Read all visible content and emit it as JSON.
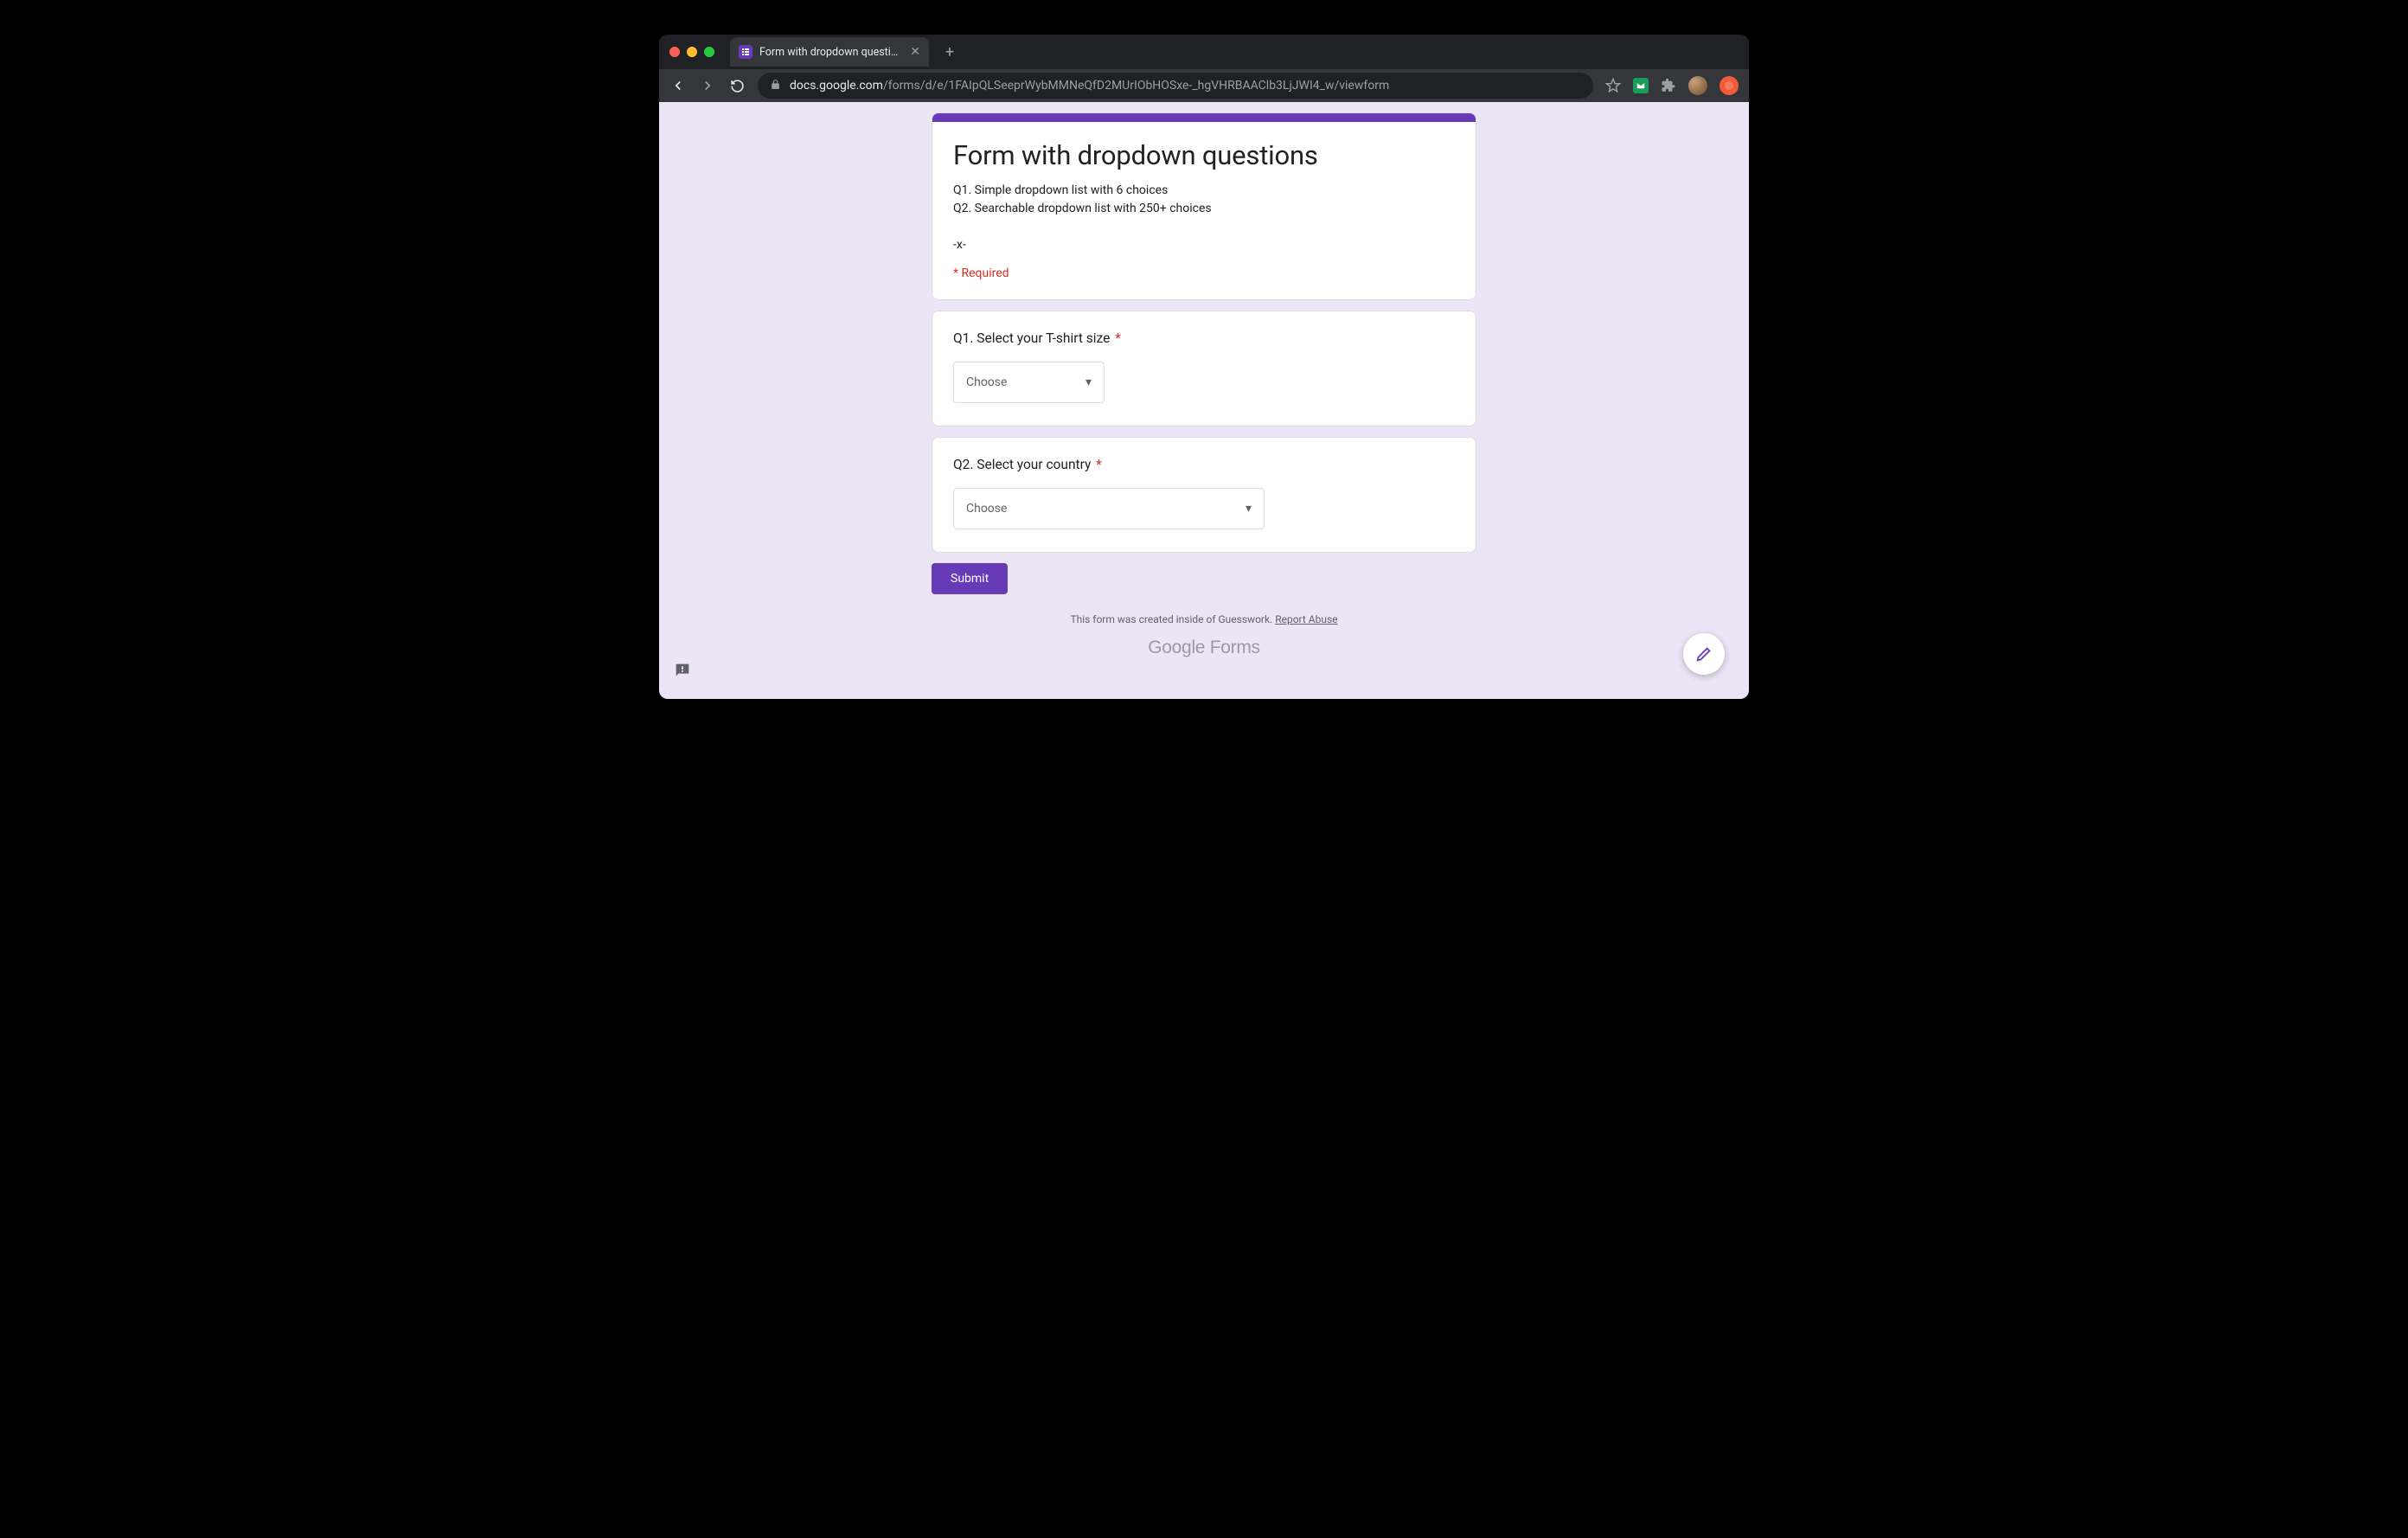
{
  "browser": {
    "tab_title": "Form with dropdown questions",
    "url_domain": "docs.google.com",
    "url_path": "/forms/d/e/1FAIpQLSeeprWybMMNeQfD2MUrIObHOSxe-_hgVHRBAAClb3LjJWI4_w/viewform"
  },
  "form": {
    "title": "Form with dropdown questions",
    "description": "Q1. Simple dropdown list with 6 choices\nQ2. Searchable dropdown list with 250+ choices\n\n-x-",
    "required_label": "* Required",
    "questions": [
      {
        "label": "Q1. Select your T-shirt size",
        "required": true,
        "placeholder": "Choose"
      },
      {
        "label": "Q2. Select your country",
        "required": true,
        "placeholder": "Choose"
      }
    ],
    "submit_label": "Submit",
    "footer_text": "This form was created inside of Guesswork. ",
    "report_abuse": "Report Abuse",
    "brand_google": "Google",
    "brand_forms": " Forms"
  }
}
